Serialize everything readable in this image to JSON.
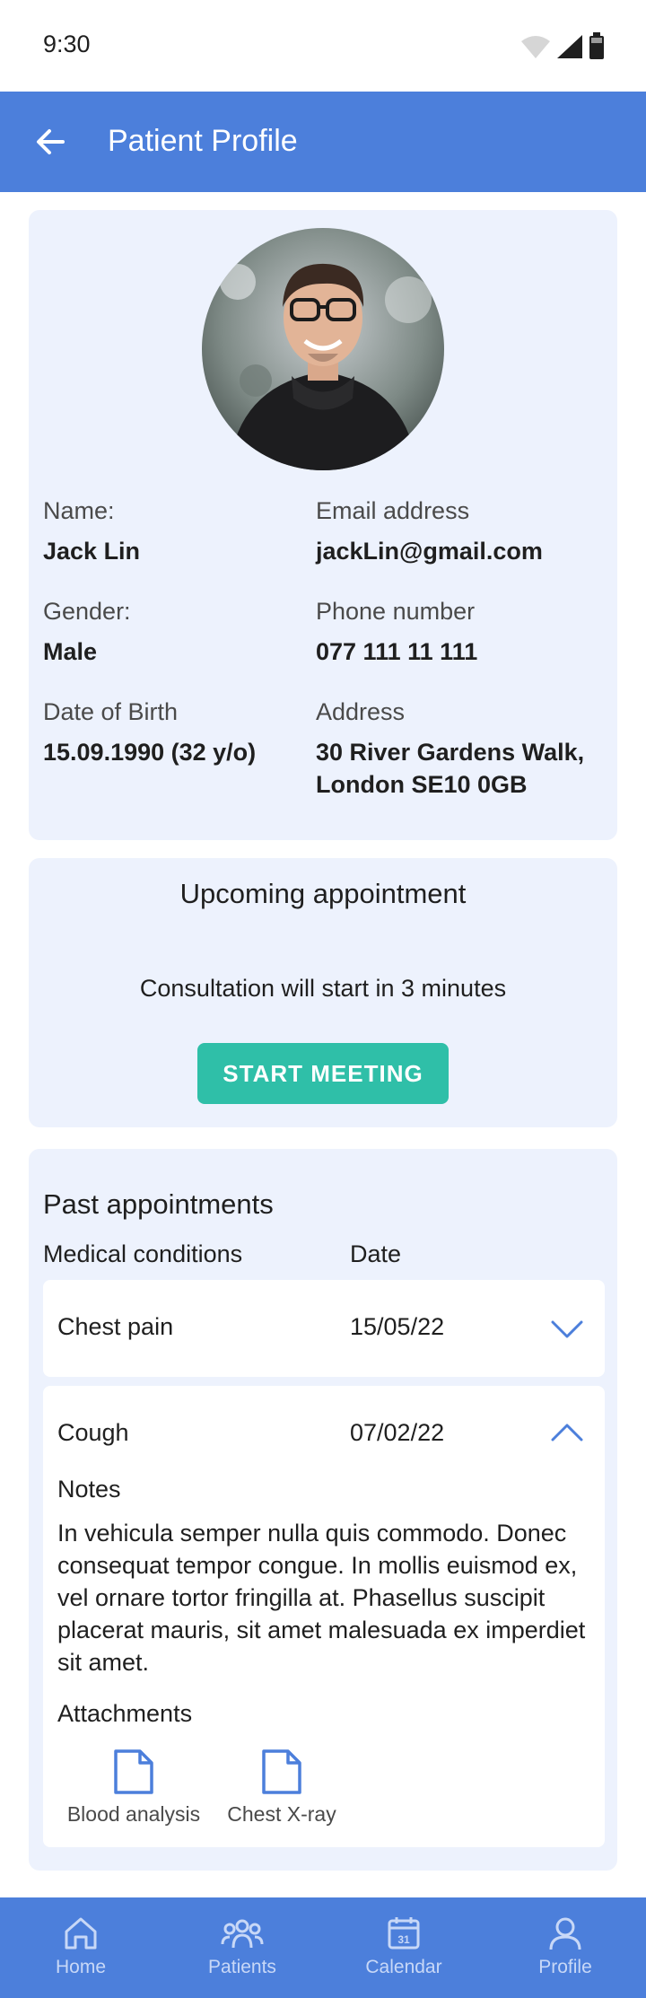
{
  "status_bar": {
    "time": "9:30"
  },
  "app_bar": {
    "title": "Patient Profile"
  },
  "profile": {
    "name_label": "Name:",
    "name_value": "Jack Lin",
    "email_label": "Email address",
    "email_value": "jackLin@gmail.com",
    "gender_label": "Gender:",
    "gender_value": "Male",
    "phone_label": "Phone number",
    "phone_value": "077 111 11 111",
    "dob_label": "Date of Birth",
    "dob_value": "15.09.1990 (32 y/o)",
    "address_label": "Address",
    "address_line1": "30 River Gardens Walk,",
    "address_line2": "London SE10 0GB"
  },
  "upcoming": {
    "title": "Upcoming appointment",
    "text": "Consultation will start in 3 minutes",
    "button_label": "START MEETING"
  },
  "past": {
    "title": "Past appointments",
    "col_conditions": "Medical conditions",
    "col_date": "Date",
    "rows": [
      {
        "condition": "Chest pain",
        "date": "15/05/22"
      },
      {
        "condition": "Cough",
        "date": "07/02/22",
        "notes_label": "Notes",
        "notes": "In vehicula semper nulla quis commodo. Donec consequat tempor congue. In mollis euismod ex, vel ornare tortor fringilla at. Phasellus suscipit placerat mauris, sit amet malesuada ex imperdiet sit amet.",
        "attachments_label": "Attachments",
        "attachments": [
          "Blood analysis",
          "Chest X-ray"
        ]
      }
    ]
  },
  "bottom_nav": {
    "items": [
      {
        "label": "Home",
        "icon": "home-icon"
      },
      {
        "label": "Patients",
        "icon": "patients-icon"
      },
      {
        "label": "Calendar",
        "icon": "calendar-icon",
        "day": "31"
      },
      {
        "label": "Profile",
        "icon": "profile-icon"
      }
    ]
  },
  "colors": {
    "primary": "#4c7fdb",
    "accent": "#2fbfa8",
    "card_bg": "#edf2fd"
  }
}
